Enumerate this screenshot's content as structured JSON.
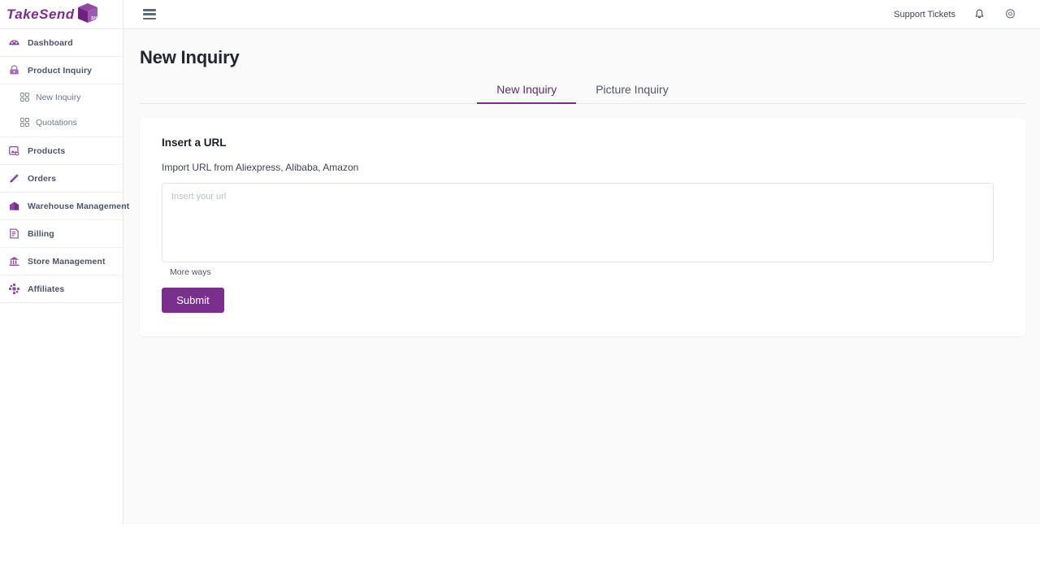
{
  "brand": {
    "name_part1": "Take",
    "name_part2": "Send",
    "box_label": "SHIP",
    "accent": "#7a2f8f"
  },
  "topbar": {
    "menu_icon": "hamburger-icon",
    "support_label": "Support Tickets",
    "bell_icon": "bell-icon",
    "settings_icon": "gear-icon"
  },
  "sidebar": {
    "items": [
      {
        "label": "Dashboard",
        "icon": "dashboard-icon"
      },
      {
        "label": "Product Inquiry",
        "icon": "briefcase-icon"
      },
      {
        "label": "Products",
        "icon": "image-icon"
      },
      {
        "label": "Orders",
        "icon": "pencil-icon"
      },
      {
        "label": "Warehouse Management",
        "icon": "warehouse-icon"
      },
      {
        "label": "Billing",
        "icon": "invoice-icon"
      },
      {
        "label": "Store Management",
        "icon": "bank-icon"
      },
      {
        "label": "Affiliates",
        "icon": "share-icon"
      }
    ],
    "subitems": [
      {
        "label": "New Inquiry",
        "icon": "grid-icon"
      },
      {
        "label": "Quotations",
        "icon": "grid-icon"
      }
    ]
  },
  "main": {
    "page_title": "New Inquiry",
    "tabs": [
      {
        "label": "New Inquiry",
        "active": true
      },
      {
        "label": "Picture Inquiry",
        "active": false
      }
    ],
    "card": {
      "title": "Insert a URL",
      "subtitle": "Import URL from Aliexpress, Alibaba, Amazon",
      "url_value": "",
      "url_placeholder": "Insert your url",
      "more_ways_label": "More ways",
      "submit_label": "Submit"
    }
  }
}
